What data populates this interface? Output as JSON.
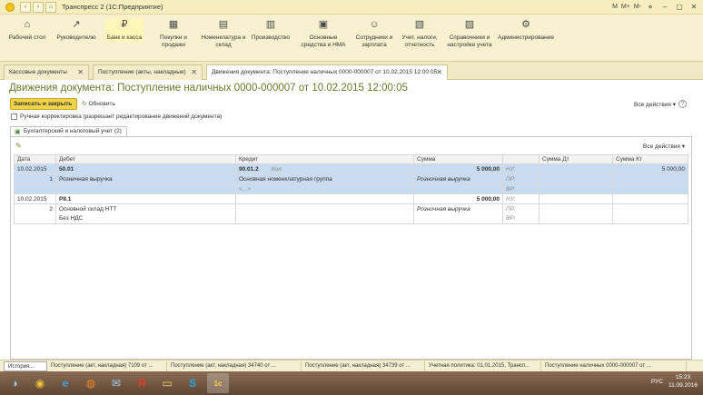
{
  "window": {
    "title": "Транспресс 2 (1С:Предприятие)",
    "right_labels": [
      "M",
      "M+",
      "M-"
    ]
  },
  "sections": [
    {
      "label": "Рабочий стол",
      "icon": "desktop-icon",
      "glyph": "⌂"
    },
    {
      "label": "Руководителю",
      "icon": "chart-icon",
      "glyph": "↗"
    },
    {
      "label": "Банк и касса",
      "icon": "bank-icon",
      "glyph": "₽"
    },
    {
      "label": "Покупки и продажи",
      "icon": "cart-icon",
      "glyph": "▦"
    },
    {
      "label": "Номенклатура и склад",
      "icon": "warehouse-icon",
      "glyph": "▤"
    },
    {
      "label": "Производство",
      "icon": "factory-icon",
      "glyph": "▥"
    },
    {
      "label": "Основные средства и НМА",
      "icon": "assets-icon",
      "glyph": "▣"
    },
    {
      "label": "Сотрудники и зарплата",
      "icon": "staff-icon",
      "glyph": "☺"
    },
    {
      "label": "Учет, налоги, отчетность",
      "icon": "reports-icon",
      "glyph": "▧"
    },
    {
      "label": "Справочники и настройки учета",
      "icon": "books-icon",
      "glyph": "▨"
    },
    {
      "label": "Администрирование",
      "icon": "gear-icon",
      "glyph": "⚙"
    }
  ],
  "tabs": [
    {
      "label": "Кассовые документы"
    },
    {
      "label": "Поступление (акты, накладные)"
    },
    {
      "label": "Движения документа: Поступление наличных 0000-000007 от 10.02.2015 12:00:05"
    }
  ],
  "form": {
    "title": "Движения документа: Поступление наличных 0000-000007 от 10.02.2015 12:00:05",
    "save_close": "Записать и закрыть",
    "refresh": "Обновить",
    "all_actions": "Все действия ▾",
    "help": "?",
    "manual_label": "Ручная корректировка (разрешает редактирование движений документа)",
    "inner_tab": "Бухгалтерский и налоговый учет (2)",
    "grid_actions": "Все действия ▾"
  },
  "grid": {
    "headers": [
      "Дата",
      "Дебет",
      "Кредит",
      "Сумма",
      "",
      "Сумма Дт",
      "Сумма Кт"
    ],
    "rows": [
      {
        "date": "10.02.2015",
        "num": "1",
        "debit_account": "50.01",
        "debit_sub1": "Розничная выручка",
        "credit_account": "90.01.2",
        "credit_kol": "Кол.",
        "credit_sub1": "Основная номенклатурная группа",
        "credit_sub2": "<...>",
        "sum": "5 000,00",
        "content": "Розничная выручка",
        "nu": "НУ:",
        "pr": "ПР:",
        "vr": "ВР:",
        "sum_kt": "5 000,00",
        "sum_dt": ""
      },
      {
        "date": "10.02.2015",
        "num": "2",
        "debit_account": "Р8.1",
        "debit_sub1": "Основной склад НТТ",
        "debit_sub2": "Без НДС",
        "credit_account": "",
        "sum": "5 000,00",
        "content": "Розничная выручка",
        "nu": "НУ:",
        "pr": "ПР:",
        "vr": "ВР:"
      }
    ]
  },
  "statusbar": [
    "История...",
    "Поступление (акт, накладная) 7109 от ...",
    "Поступление (акт, накладная) 34740 от ...",
    "Поступление (акт, накладная) 34739 от ...",
    "Учетная политика: 01.01.2015, Трансп...",
    "Поступление наличных 0000-000007 от ..."
  ],
  "taskbar": {
    "apps": [
      {
        "name": "windows-start-icon",
        "glyph": "◑"
      },
      {
        "name": "chrome-icon",
        "glyph": "◉"
      },
      {
        "name": "ie-icon",
        "glyph": "e"
      },
      {
        "name": "firefox-icon",
        "glyph": "◍"
      },
      {
        "name": "mail-icon",
        "glyph": "✉"
      },
      {
        "name": "yandex-icon",
        "glyph": "Я"
      },
      {
        "name": "folder-icon",
        "glyph": "▭"
      },
      {
        "name": "skype-icon",
        "glyph": "S"
      },
      {
        "name": "1c-icon",
        "glyph": "1с"
      }
    ],
    "lang": "РУС",
    "time": "15:23",
    "date": "11.09.2016"
  }
}
